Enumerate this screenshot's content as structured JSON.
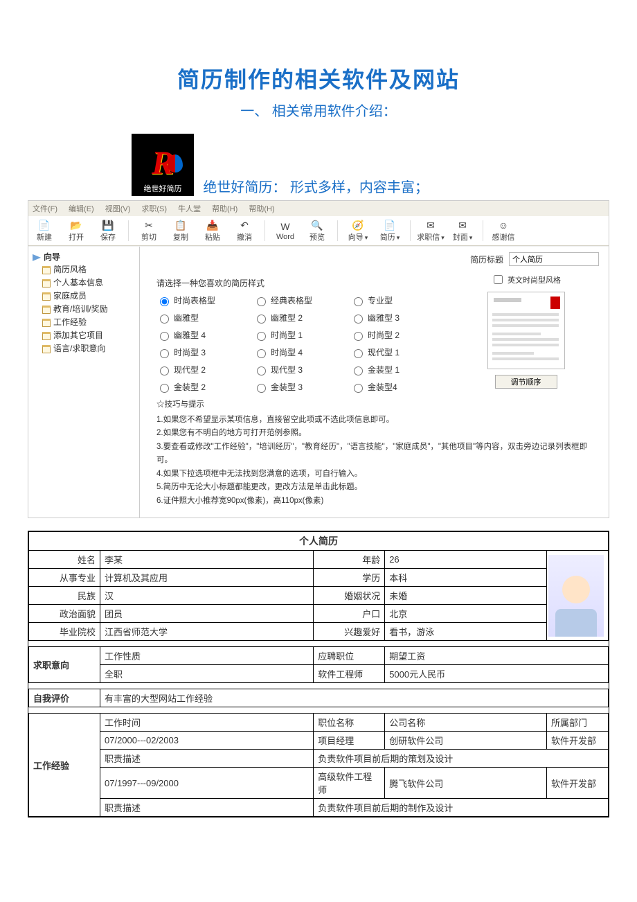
{
  "doc_title": "简历制作的相关软件及网站",
  "section1_heading": "一、  相关常用软件介绍：",
  "app_icon_label": "绝世好简历",
  "app_caption": "绝世好简历：  形式多样，内容丰富；",
  "menubar": [
    "文件(F)",
    "编辑(E)",
    "视图(V)",
    "求职(S)",
    "牛人堂",
    "帮助(H)",
    "帮助(H)"
  ],
  "toolbar": [
    {
      "icon": "📄",
      "label": "新建"
    },
    {
      "icon": "📂",
      "label": "打开"
    },
    {
      "icon": "💾",
      "label": "保存"
    },
    {
      "sep": true
    },
    {
      "icon": "✂",
      "label": "剪切"
    },
    {
      "icon": "📋",
      "label": "复制"
    },
    {
      "icon": "📥",
      "label": "粘贴"
    },
    {
      "icon": "↶",
      "label": "撤消"
    },
    {
      "sep": true
    },
    {
      "icon": "W",
      "label": "Word"
    },
    {
      "icon": "🔍",
      "label": "预览"
    },
    {
      "sep": true
    },
    {
      "icon": "🧭",
      "label": "向导"
    },
    {
      "icon": "📄",
      "label": "简历"
    },
    {
      "sep": true
    },
    {
      "icon": "✉",
      "label": "求职信"
    },
    {
      "icon": "✉",
      "label": "封面"
    },
    {
      "sep": true
    },
    {
      "icon": "☺",
      "label": "感谢信"
    }
  ],
  "tree": {
    "root": "向导",
    "nodes": [
      "简历风格",
      "个人基本信息",
      "家庭成员",
      "教育/培训/奖励",
      "工作经验",
      "添加其它项目",
      "语言/求职意向"
    ]
  },
  "title_field": {
    "label": "简历标题",
    "value": "个人简历"
  },
  "style_prompt": "请选择一种您喜欢的简历样式",
  "style_options": [
    {
      "label": "时尚表格型",
      "checked": true
    },
    {
      "label": "经典表格型"
    },
    {
      "label": "专业型"
    },
    {
      "label": "幽雅型"
    },
    {
      "label": "幽雅型 2"
    },
    {
      "label": "幽雅型 3"
    },
    {
      "label": "幽雅型 4"
    },
    {
      "label": "时尚型 1"
    },
    {
      "label": "时尚型 2"
    },
    {
      "label": "时尚型 3"
    },
    {
      "label": "时尚型 4"
    },
    {
      "label": "现代型 1"
    },
    {
      "label": "现代型 2"
    },
    {
      "label": "现代型 3"
    },
    {
      "label": "金装型 1"
    },
    {
      "label": "金装型 2"
    },
    {
      "label": "金装型 3"
    },
    {
      "label": "金装型4"
    }
  ],
  "preview_checkbox": "英文时尚型风格",
  "adjust_button": "调节顺序",
  "tips_heading": "☆技巧与提示",
  "tips": [
    "1.如果您不希望显示某项信息，直接留空此项或不选此项信息即可。",
    "2.如果您有不明白的地方可打开范例参照。",
    "3.要查看或修改\"工作经验\"，\"培训经历\"，\"教育经历\"，\"语言技能\"，\"家庭成员\"，\"其他项目\"等内容，双击旁边记录列表框即可。",
    "4.如果下拉选项框中无法找到您满意的选项，可自行输入。",
    "5.简历中无论大小标题都能更改，更改方法是单击此标题。",
    "6.证件照大小推荐宽90px(像素)，高110px(像素)"
  ],
  "resume": {
    "header": "个人简历",
    "rows": [
      {
        "l1": "姓名",
        "v1": "李某",
        "l2": "年龄",
        "v2": "26"
      },
      {
        "l1": "从事专业",
        "v1": "计算机及其应用",
        "l2": "学历",
        "v2": "本科"
      },
      {
        "l1": "民族",
        "v1": "汉",
        "l2": "婚姻状况",
        "v2": "未婚"
      },
      {
        "l1": "政治面貌",
        "v1": "团员",
        "l2": "户口",
        "v2": "北京"
      },
      {
        "l1": "毕业院校",
        "v1": "江西省师范大学",
        "l2": "兴趣爱好",
        "v2": "看书，游泳"
      }
    ],
    "job_intent": {
      "heading": "求职意向",
      "h1": "工作性质",
      "h2": "应聘职位",
      "h3": "期望工资",
      "v1": "全职",
      "v2": "软件工程师",
      "v3": "5000元人民币"
    },
    "self_eval": {
      "heading": "自我评价",
      "value": "有丰富的大型网站工作经验"
    },
    "work_exp": {
      "heading": "工作经验",
      "cols": [
        "工作时间",
        "职位名称",
        "公司名称",
        "所属部门"
      ],
      "desc_label": "职责描述",
      "rows": [
        {
          "time": "07/2000---02/2003",
          "title": "项目经理",
          "company": "创研软件公司",
          "dept": "软件开发部",
          "desc": "负责软件项目前后期的策划及设计"
        },
        {
          "time": "07/1997---09/2000",
          "title": "高级软件工程师",
          "company": "腾飞软件公司",
          "dept": "软件开发部",
          "desc": "负责软件项目前后期的制作及设计"
        }
      ]
    }
  }
}
